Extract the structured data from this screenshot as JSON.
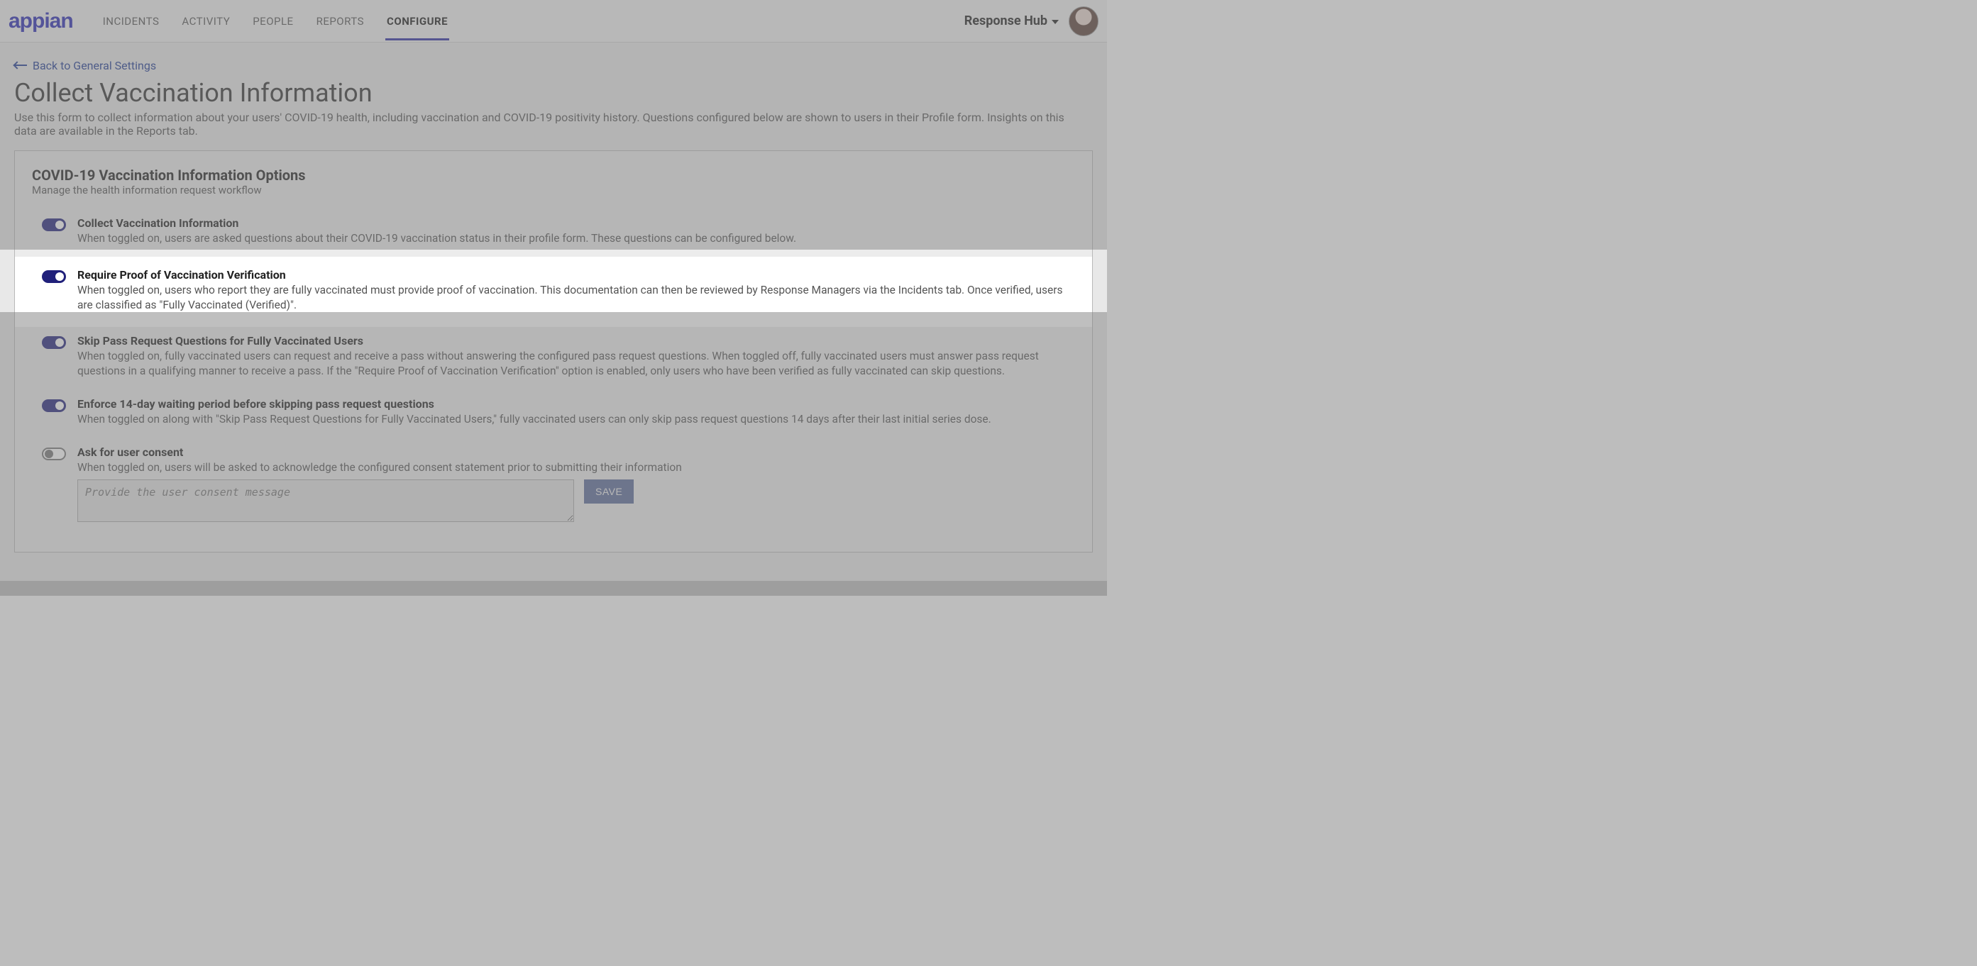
{
  "brand": "appian",
  "nav": {
    "items": [
      "INCIDENTS",
      "ACTIVITY",
      "PEOPLE",
      "REPORTS",
      "CONFIGURE"
    ],
    "active_index": 4
  },
  "site_switch_label": "Response Hub",
  "back_link": "Back to General Settings",
  "page_title": "Collect Vaccination Information",
  "page_sub": "Use this form to collect information about your users' COVID-19 health, including vaccination and COVID-19 positivity history. Questions configured below are shown to users in their Profile form. Insights on this data are available in the Reports tab.",
  "card": {
    "title": "COVID-19 Vaccination Information Options",
    "sub": "Manage the health information request workflow"
  },
  "options": [
    {
      "id": "collect",
      "on": true,
      "title": "Collect Vaccination Information",
      "desc": "When toggled on, users are asked questions about their COVID-19 vaccination status in their profile form. These questions can be configured below.",
      "highlight": false
    },
    {
      "id": "require-proof",
      "on": true,
      "title": "Require Proof of Vaccination Verification",
      "desc": "When toggled on, users who report they are fully vaccinated must provide proof of vaccination. This documentation can then be reviewed by Response Managers via the Incidents tab. Once verified, users are classified as \"Fully Vaccinated (Verified)\".",
      "highlight": true
    },
    {
      "id": "skip-pass",
      "on": true,
      "title": "Skip Pass Request Questions for Fully Vaccinated Users",
      "desc": "When toggled on, fully vaccinated users can request and receive a pass without answering the configured pass request questions. When toggled off, fully vaccinated users must answer pass request questions in a qualifying manner to receive a pass. If the \"Require Proof of Vaccination Verification\" option is enabled, only users who have been verified as fully vaccinated can skip questions.",
      "highlight": false
    },
    {
      "id": "enforce-14",
      "on": true,
      "title": "Enforce 14-day waiting period before skipping pass request questions",
      "desc": "When toggled on along with \"Skip Pass Request Questions for Fully Vaccinated Users,\" fully vaccinated users can only skip pass request questions 14 days after their last initial series dose.",
      "highlight": false
    },
    {
      "id": "ask-consent",
      "on": false,
      "title": "Ask for user consent",
      "desc": "When toggled on, users will be asked to acknowledge the configured consent statement prior to submitting their information",
      "highlight": false
    }
  ],
  "consent": {
    "placeholder": "Provide the user consent message",
    "save_label": "SAVE"
  },
  "colors": {
    "brand_purple": "#2828b3",
    "toggle_on": "#20207a",
    "save_button": "#5b6a99"
  }
}
